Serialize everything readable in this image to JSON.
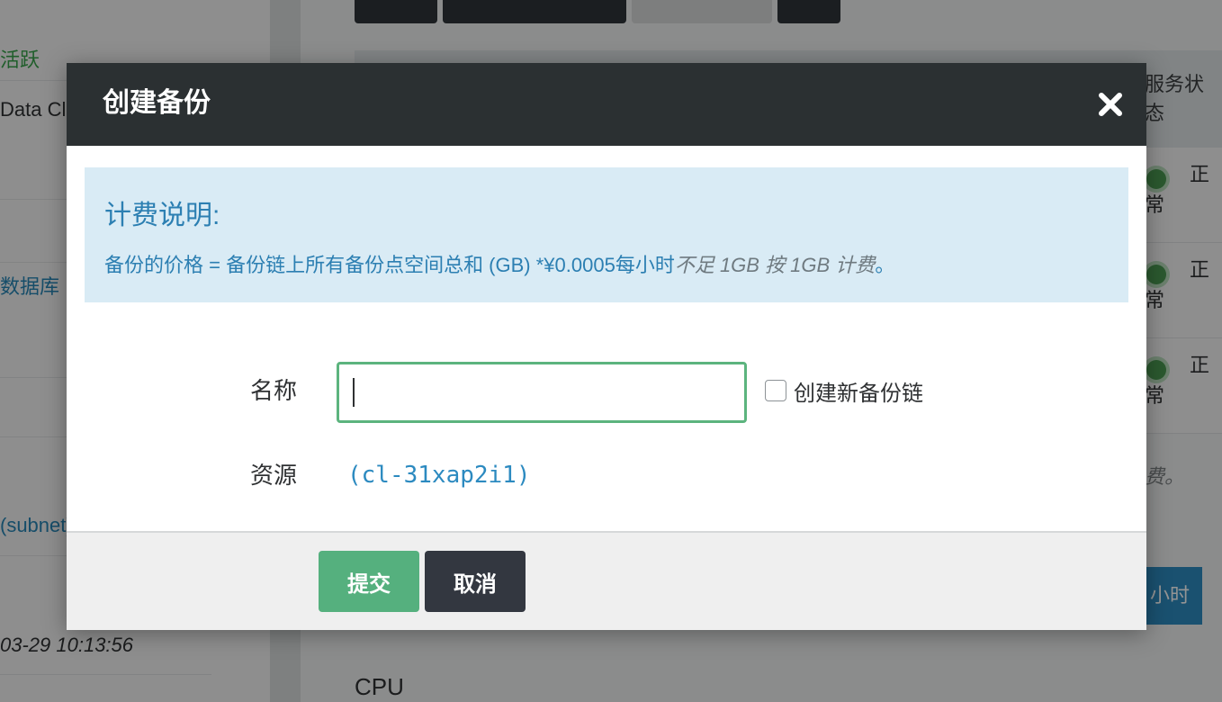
{
  "background": {
    "sidebar": {
      "items": [
        "活跃",
        "Data Cluster",
        "数据库",
        "(subnet)"
      ],
      "timestamp": "03-29 10:13:56"
    },
    "table": {
      "status_header": "服务状态",
      "rows": [
        {
          "status_top": "正",
          "status_bottom": "常"
        },
        {
          "status_top": "正",
          "status_bottom": "常"
        },
        {
          "status_top": "正",
          "status_bottom": "常"
        }
      ]
    },
    "note": "费。",
    "time_button": "小时",
    "section_label": "CPU"
  },
  "modal": {
    "title": "创建备份",
    "close_icon": "close-icon",
    "billing": {
      "title": "计费说明:",
      "text_main": "备份的价格 = 备份链上所有备份点空间总和 (GB) *¥0.0005每小时",
      "text_italic": "不足 1GB 按 1GB 计费",
      "text_end": "。"
    },
    "form": {
      "name_label": "名称",
      "name_value": "",
      "new_chain_label": "创建新备份链",
      "new_chain_checked": false,
      "resource_label": "资源",
      "resource_value": "(cl-31xap2i1)"
    },
    "footer": {
      "submit_label": "提交",
      "cancel_label": "取消"
    },
    "colors": {
      "header_bg": "#2b3032",
      "info_bg": "#d9ebf5",
      "info_text": "#2c7fb2",
      "submit_bg": "#55b07e",
      "cancel_bg": "#333740",
      "input_border": "#5cb47e"
    }
  }
}
